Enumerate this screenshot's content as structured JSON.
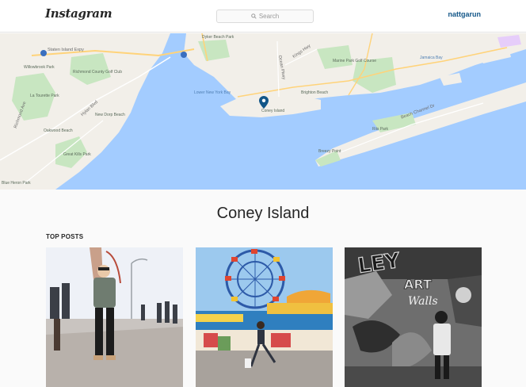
{
  "header": {
    "logo_text": "Instagram",
    "search_placeholder": "Search",
    "username": "nattgarun"
  },
  "map": {
    "labels": {
      "staten_island_expy": "Staten Island Expy",
      "willowbrook_park": "Willowbrook Park",
      "richmond_county_golf": "Richmond County Golf Club",
      "la_tourette": "La Tourette Park",
      "richmond_ave": "Richmond Ave",
      "hylan_blvd": "Hylan Blvd",
      "great_kills": "Great Kills Park",
      "new_dorp": "New Dorp Beach",
      "oakwood": "Oakwood Beach",
      "blue_heron": "Blue Heron Park",
      "lower_ny_bay": "Lower New York Bay",
      "dyker_beach": "Dyker Beach Park",
      "marine_park_golf": "Marine Park Golf Course",
      "ocean_pkwy": "Ocean Pkwy",
      "kings_hwy": "Kings Hwy",
      "coney_island": "Coney Island",
      "brighton_beach": "Brighton Beach",
      "beach_channel": "Beach Channel Dr",
      "riis_park": "Riis Park",
      "breezy_point": "Breezy Point",
      "jfk": "Jamaica Bay"
    },
    "colors": {
      "water": "#a3ccff",
      "land": "#f2efe9",
      "park": "#c8e6c1",
      "highway": "#ffd37a"
    }
  },
  "place": {
    "title": "Coney Island"
  },
  "top_posts": {
    "label": "TOP POSTS"
  },
  "posts": [
    {
      "subject": "woman-on-boardwalk"
    },
    {
      "subject": "wonder-wheel-amusement"
    },
    {
      "subject": "graffiti-art-wall"
    }
  ]
}
